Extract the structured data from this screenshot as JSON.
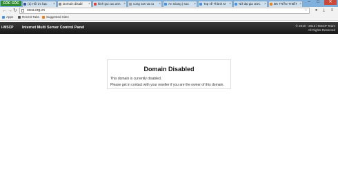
{
  "browser": {
    "logo_label": "CỐC CỐC",
    "tabs": [
      {
        "label": "(1) Hồi ức bạc",
        "active": false,
        "color": "#3b5998"
      },
      {
        "label": "Domain disabl",
        "active": true,
        "color": "#888888"
      },
      {
        "label": "kinh gui cac ann",
        "active": false,
        "color": "#d44638"
      },
      {
        "label": "cong van va cu",
        "active": false,
        "color": "#999999"
      },
      {
        "label": "An Giang | suu",
        "active": false,
        "color": "#4a90d9"
      },
      {
        "label": "Top về Thành M",
        "active": false,
        "color": "#4a90d9"
      },
      {
        "label": "Nữ đại gia USC",
        "active": false,
        "color": "#4a90d9"
      },
      {
        "label": "ĐK TRẦN THIẾT",
        "active": false,
        "color": "#e67e22"
      }
    ],
    "window_controls": {
      "minimize": "–",
      "maximize": "□",
      "close": "✕"
    },
    "nav": {
      "back": "←",
      "forward": "→",
      "reload": "↻"
    },
    "address": {
      "url": "oxca.org.vn",
      "star_icon": "star-icon"
    },
    "toolbar_icons": [
      "lock-icon",
      "download-icon",
      "menu-icon"
    ],
    "bookmarks": [
      {
        "label": "Apps",
        "color": "#4a90d9"
      },
      {
        "label": "Recent Tabs",
        "color": "#555555"
      },
      {
        "label": "Suggested Sites",
        "color": "#e67e22"
      }
    ]
  },
  "msp": {
    "logo_text": "MSCP",
    "title": "Internet Multi Server Control Panel",
    "copyright_line1": "© 2010 - 2013 i-MSCP Team",
    "copyright_line2": "All Rights Reserved"
  },
  "content": {
    "heading": "Domain Disabled",
    "line1": "This domain is currently disabled.",
    "line2": "Please get in contact with your reseller if you are the owner of this domain."
  }
}
